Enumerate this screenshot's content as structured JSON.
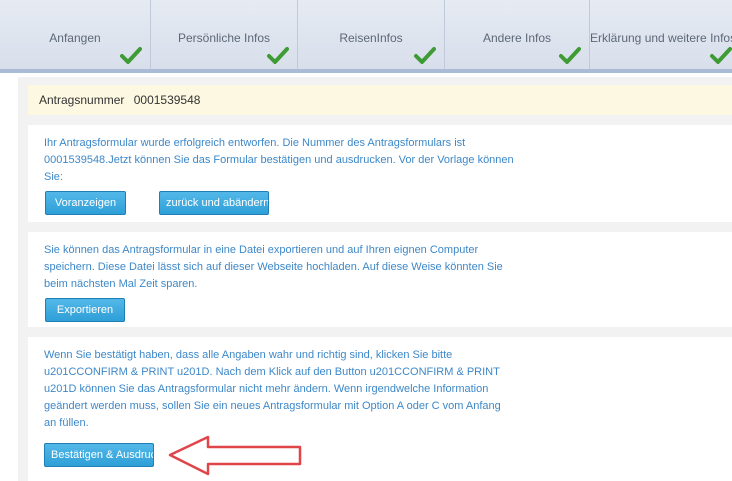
{
  "steps": [
    {
      "label": "Anfangen",
      "completed": true
    },
    {
      "label": "Persönliche Infos",
      "completed": true
    },
    {
      "label": "ReisenInfos",
      "completed": true
    },
    {
      "label": "Andere Infos",
      "completed": true
    },
    {
      "label": "Erklärung und weitere Infos",
      "completed": true
    }
  ],
  "colors": {
    "check": "#3f9c35",
    "link_text": "#3d88c9",
    "button": "#3aa7dd",
    "arrow": "#e0454a",
    "app_number_bg": "#fdf8e2"
  },
  "application": {
    "label": "Antragsnummer",
    "number": "0001539548"
  },
  "panel_preview": {
    "text": "Ihr Antragsformular wurde erfolgreich entworfen. Die Nummer des Antragsformulars ist 0001539548.Jetzt können Sie das Formular bestätigen und ausdrucken. Vor der Vorlage können Sie:",
    "preview_button": "Voranzeigen",
    "back_button": "zurück und abändern"
  },
  "panel_export": {
    "text": "Sie können das Antragsformular in eine Datei exportieren und auf Ihren eignen Computer speichern. Diese Datei lässt sich auf dieser Webseite hochladen. Auf diese Weise könnten Sie beim nächsten Mal Zeit sparen.",
    "export_button": "Exportieren"
  },
  "panel_confirm": {
    "text": "Wenn Sie bestätigt haben, dass alle Angaben wahr und richtig sind, klicken Sie bitte u201CCONFIRM & PRINT u201D. Nach dem Klick auf den Button u201CCONFIRM & PRINT u201D können Sie das Antragsformular nicht mehr ändern. Wenn irgendwelche Information geändert werden muss, sollen Sie ein neues Antragsformular mit Option A oder C vom Anfang an füllen.",
    "confirm_button": "Bestätigen & Ausdrucken"
  }
}
